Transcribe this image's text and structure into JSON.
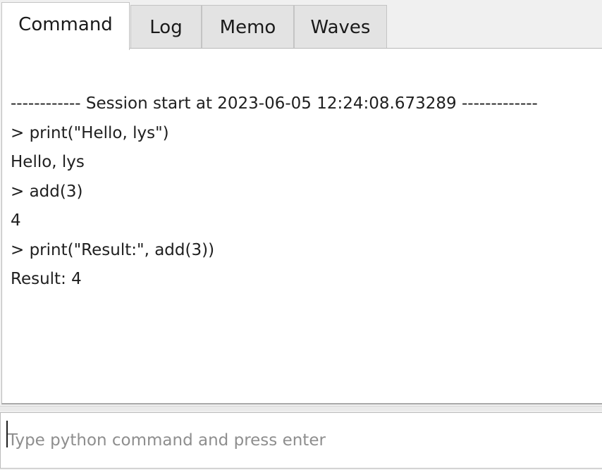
{
  "tabs": [
    {
      "label": "Command",
      "active": true
    },
    {
      "label": "Log",
      "active": false
    },
    {
      "label": "Memo",
      "active": false
    },
    {
      "label": "Waves",
      "active": false
    }
  ],
  "output": {
    "lines": [
      "------------ Session start at 2023-06-05 12:24:08.673289 -------------",
      "> print(\"Hello, lys\")",
      "Hello, lys",
      "> add(3)",
      "4",
      "> print(\"Result:\", add(3))",
      "Result: 4"
    ]
  },
  "command_input": {
    "value": "",
    "placeholder": "Type python command and press enter"
  },
  "colors": {
    "active_tab_bg": "#ffffff",
    "inactive_tab_bg": "#e3e3e3",
    "panel_bg": "#ffffff",
    "window_bg": "#f0f0f0",
    "placeholder_text": "#8e8e8e"
  }
}
